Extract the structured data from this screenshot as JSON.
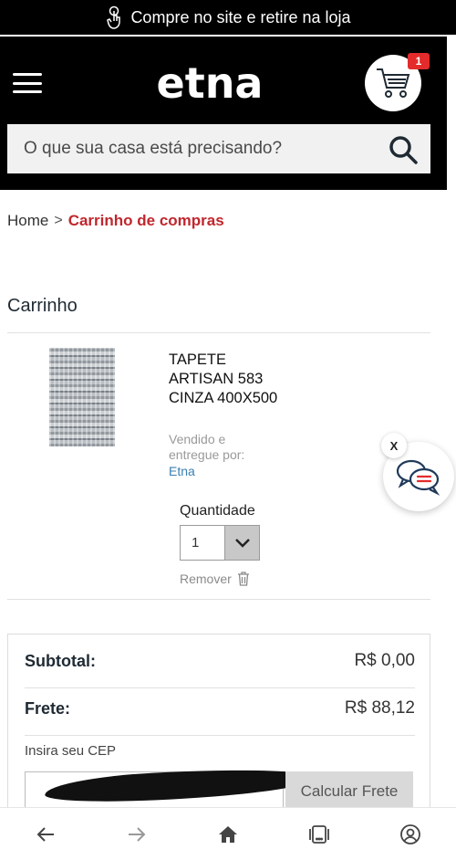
{
  "promo": {
    "text": "Compre no site e retire na loja",
    "icon": "touch-hand-icon"
  },
  "header": {
    "logo": "etna",
    "cart_count": "1",
    "search_placeholder": "O que sua casa está precisando?"
  },
  "breadcrumb": {
    "home": "Home",
    "separator": ">",
    "current": "Carrinho de compras"
  },
  "cart": {
    "title": "Carrinho",
    "item": {
      "name": "TAPETE ARTISAN 583 CINZA 400X500",
      "sold_by": "Vendido e entregue por:",
      "seller": "Etna",
      "quantity_label": "Quantidade",
      "quantity_value": "1",
      "remove_label": "Remover"
    }
  },
  "chat": {
    "close_label": "X"
  },
  "summary": {
    "subtotal_label": "Subtotal:",
    "subtotal_value": "R$ 0,00",
    "shipping_label": "Frete:",
    "shipping_value": "R$ 88,12",
    "cep_label": "Insira seu CEP",
    "calc_button": "Calcular Frete"
  },
  "colors": {
    "accent_red": "#c0272d",
    "link_blue": "#3a7fb0",
    "header_bg": "#000000"
  }
}
